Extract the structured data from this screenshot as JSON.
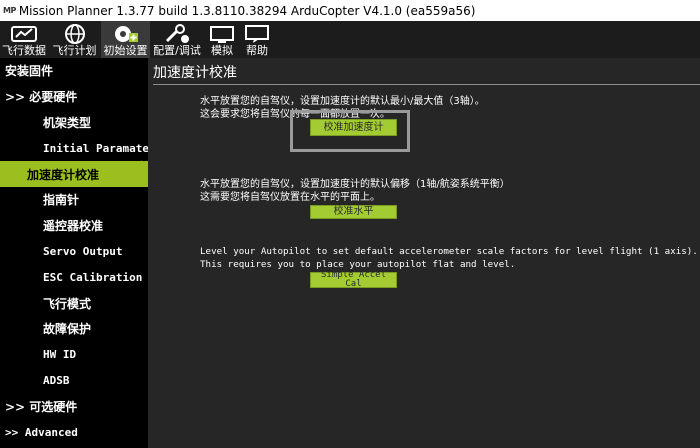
{
  "window": {
    "logo": "MP",
    "title": "Mission Planner 1.3.77 build 1.3.8110.38294 ArduCopter V4.1.0 (ea559a56)"
  },
  "toolbar": {
    "items": [
      {
        "label": "飞行数据",
        "icon": "flight-data-icon"
      },
      {
        "label": "飞行计划",
        "icon": "flight-plan-globe-icon"
      },
      {
        "label": "初始设置",
        "icon": "initial-setup-icon"
      },
      {
        "label": "配置/调试",
        "icon": "config-tuning-icon"
      },
      {
        "label": "模拟",
        "icon": "simulation-icon"
      },
      {
        "label": "帮助",
        "icon": "help-icon"
      }
    ]
  },
  "sidebar": {
    "items": [
      {
        "label": "安装固件"
      },
      {
        "label": ">> 必要硬件"
      },
      {
        "label": "机架类型"
      },
      {
        "label": "Initial Paramate"
      },
      {
        "label": "加速度计校准"
      },
      {
        "label": "指南针"
      },
      {
        "label": "遥控器校准"
      },
      {
        "label": "Servo Output"
      },
      {
        "label": "ESC Calibration"
      },
      {
        "label": "飞行模式"
      },
      {
        "label": "故障保护"
      },
      {
        "label": "HW ID"
      },
      {
        "label": "ADSB"
      },
      {
        "label": ">> 可选硬件"
      },
      {
        "label": ">> Advanced"
      }
    ]
  },
  "main": {
    "title": "加速度计校准",
    "section1": {
      "line1": "水平放置您的自驾仪，设置加速度计的默认最小/最大值（3轴）。",
      "line2": "这会要求您将自驾仪的每一面都放置一次。",
      "button": "校准加速度计"
    },
    "section2": {
      "line1": "水平放置您的自驾仪，设置加速度计的默认偏移（1轴/航姿系统平衡）",
      "line2": "这需要您将自驾仪放置在水平的平面上。",
      "button": "校准水平"
    },
    "section3": {
      "line1": "Level your Autopilot to set default accelerometer scale factors for level flight (1 axis).",
      "line2": "This requires you to place your autopilot flat and level.",
      "button_line1": "Simple Accel",
      "button_line2": "Cal"
    }
  },
  "colors": {
    "accent": "#9bbf1f",
    "button": "#a3cc33",
    "background": "#262626"
  }
}
